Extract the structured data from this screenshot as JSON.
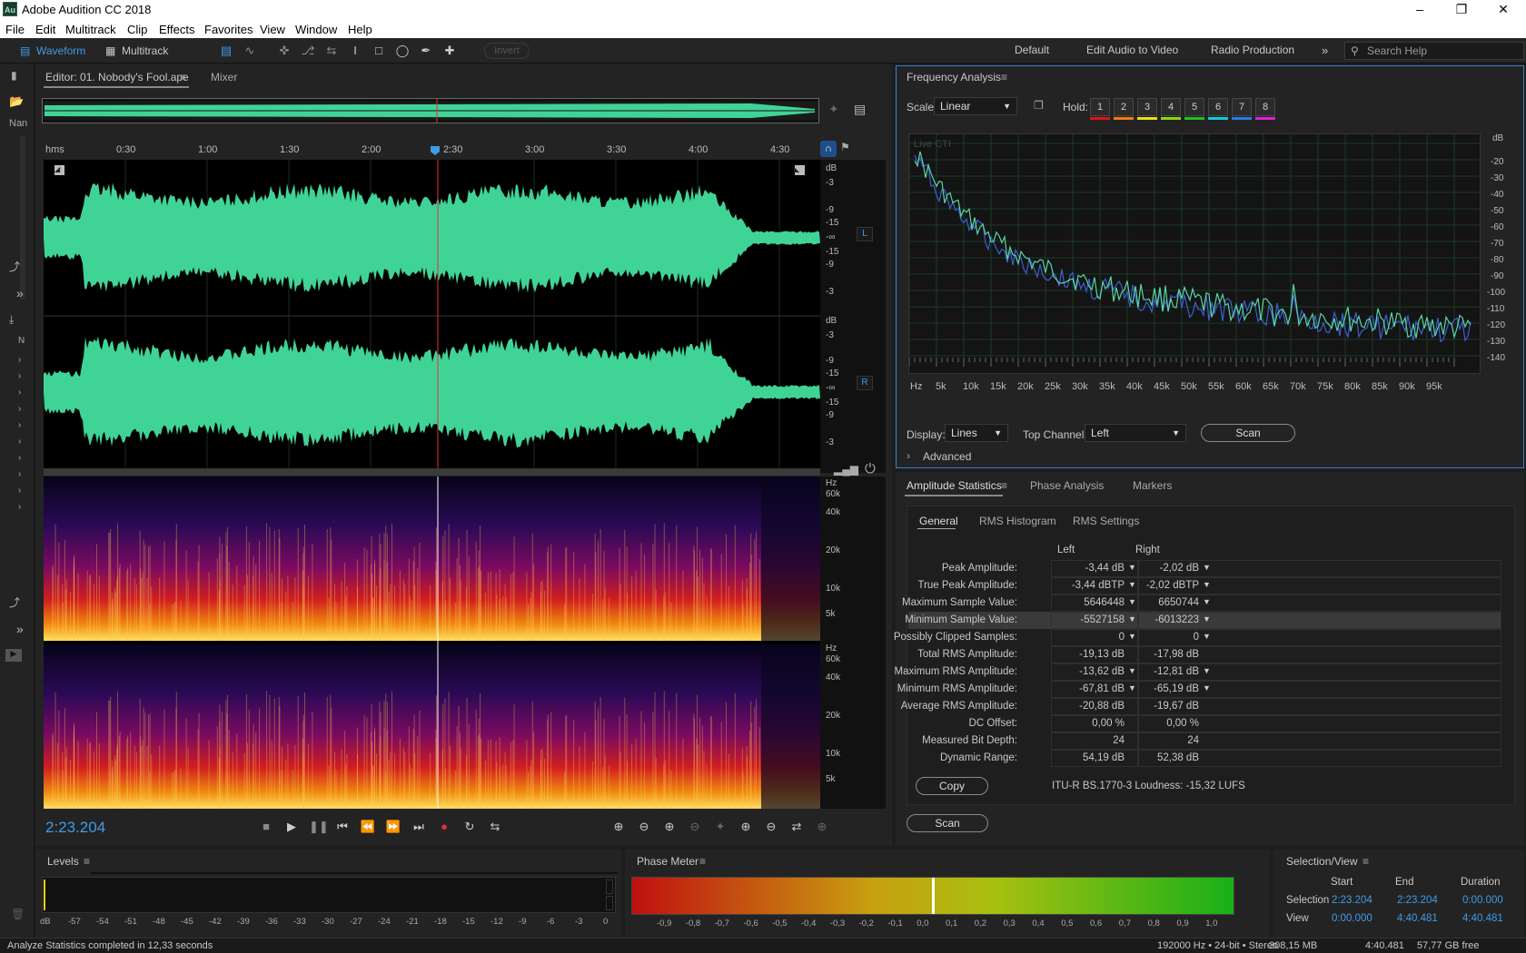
{
  "app": {
    "title": "Adobe Audition CC 2018",
    "logo": "Au"
  },
  "menu": [
    "File",
    "Edit",
    "Multitrack",
    "Clip",
    "Effects",
    "Favorites",
    "View",
    "Window",
    "Help"
  ],
  "toolbar": {
    "waveform_label": "Waveform",
    "multitrack_label": "Multitrack",
    "invert_label": "Invert",
    "workspaces": [
      "Default",
      "Edit Audio to Video",
      "Radio Production"
    ],
    "search_placeholder": "Search Help"
  },
  "left_strip": {
    "label_1": "Nan",
    "label_2": "N"
  },
  "editor": {
    "tab_label": "Editor: 01. Nobody's Fool.ape",
    "mixer_label": "Mixer",
    "ruler": {
      "unit": "hms",
      "ticks": [
        "0:30",
        "1:00",
        "1:30",
        "2:00",
        "2:30",
        "3:00",
        "3:30",
        "4:00",
        "4:30"
      ]
    },
    "channel_left": "L",
    "channel_right": "R",
    "db_unit": "dB",
    "db_labels_top": [
      "-3",
      "-9",
      "-15",
      "-∞",
      "-15",
      "-9",
      "-3"
    ],
    "db_labels_bottom": [
      "-3",
      "-9",
      "-15",
      "-∞",
      "-15",
      "-9",
      "-3"
    ],
    "hz_unit": "Hz",
    "hz_labels": [
      "60k",
      "40k",
      "20k",
      "10k",
      "5k"
    ],
    "timecode": "2:23.204"
  },
  "frequency_analysis": {
    "title": "Frequency Analysis",
    "scale_label": "Scale:",
    "scale_value": "Linear",
    "hold_label": "Hold:",
    "hold_buttons": [
      "1",
      "2",
      "3",
      "4",
      "5",
      "6",
      "7",
      "8"
    ],
    "hold_colors": [
      "#e01515",
      "#f07a10",
      "#e8e010",
      "#8ad814",
      "#20c020",
      "#12c8e0",
      "#2a7ae8",
      "#e020d8"
    ],
    "live_label": "Live CTI",
    "y_unit": "dB",
    "y_ticks": [
      "-20",
      "-30",
      "-40",
      "-50",
      "-60",
      "-70",
      "-80",
      "-90",
      "-100",
      "-110",
      "-120",
      "-130",
      "-140"
    ],
    "x_ticks": [
      "Hz",
      "5k",
      "10k",
      "15k",
      "20k",
      "25k",
      "30k",
      "35k",
      "40k",
      "45k",
      "50k",
      "55k",
      "60k",
      "65k",
      "70k",
      "75k",
      "80k",
      "85k",
      "90k",
      "95k"
    ],
    "display_label": "Display:",
    "display_value": "Lines",
    "top_channel_label": "Top Channel:",
    "top_channel_value": "Left",
    "scan_label": "Scan",
    "advanced_label": "Advanced"
  },
  "amplitude": {
    "tabs": [
      "Amplitude Statistics",
      "Phase Analysis",
      "Markers"
    ],
    "subtabs": [
      "General",
      "RMS Histogram",
      "RMS Settings"
    ],
    "col_left": "Left",
    "col_right": "Right",
    "rows": [
      {
        "label": "Peak Amplitude:",
        "left": "-3,44 dB",
        "right": "-2,02 dB",
        "pin": true
      },
      {
        "label": "True Peak Amplitude:",
        "left": "-3,44 dBTP",
        "right": "-2,02 dBTP",
        "pin": true
      },
      {
        "label": "Maximum Sample Value:",
        "left": "5646448",
        "right": "6650744",
        "pin": true
      },
      {
        "label": "Minimum Sample Value:",
        "left": "-5527158",
        "right": "-6013223",
        "pin": true
      },
      {
        "label": "Possibly Clipped Samples:",
        "left": "0",
        "right": "0",
        "pin": true
      },
      {
        "label": "Total RMS Amplitude:",
        "left": "-19,13 dB",
        "right": "-17,98 dB",
        "pin": false
      },
      {
        "label": "Maximum RMS Amplitude:",
        "left": "-13,62 dB",
        "right": "-12,81 dB",
        "pin": true
      },
      {
        "label": "Minimum RMS Amplitude:",
        "left": "-67,81 dB",
        "right": "-65,19 dB",
        "pin": true
      },
      {
        "label": "Average RMS Amplitude:",
        "left": "-20,88 dB",
        "right": "-19,67 dB",
        "pin": false
      },
      {
        "label": "DC Offset:",
        "left": "0,00 %",
        "right": "0,00 %",
        "pin": false
      },
      {
        "label": "Measured Bit Depth:",
        "left": "24",
        "right": "24",
        "pin": false
      },
      {
        "label": "Dynamic Range:",
        "left": "54,19 dB",
        "right": "52,38 dB",
        "pin": false
      }
    ],
    "copy_label": "Copy",
    "loudness": "ITU-R BS.1770-3 Loudness: -15,32 LUFS",
    "scan_label": "Scan"
  },
  "levels": {
    "title": "Levels",
    "ticks": [
      "dB",
      "-57",
      "-54",
      "-51",
      "-48",
      "-45",
      "-42",
      "-39",
      "-36",
      "-33",
      "-30",
      "-27",
      "-24",
      "-21",
      "-18",
      "-15",
      "-12",
      "-9",
      "-6",
      "-3",
      "0"
    ]
  },
  "phase_meter": {
    "title": "Phase Meter",
    "ticks": [
      "-0,9",
      "-0,8",
      "-0,7",
      "-0,6",
      "-0,5",
      "-0,4",
      "-0,3",
      "-0,2",
      "-0,1",
      "0,0",
      "0,1",
      "0,2",
      "0,3",
      "0,4",
      "0,5",
      "0,6",
      "0,7",
      "0,8",
      "0,9",
      "1,0"
    ]
  },
  "selection_view": {
    "title": "Selection/View",
    "col_start": "Start",
    "col_end": "End",
    "col_duration": "Duration",
    "selection_label": "Selection",
    "selection_start": "2:23.204",
    "selection_end": "2:23.204",
    "selection_duration": "0:00.000",
    "view_label": "View",
    "view_start": "0:00.000",
    "view_end": "4:40.481",
    "view_duration": "4:40.481"
  },
  "status": {
    "message": "Analyze Statistics completed in 12,33 seconds",
    "format": "192000 Hz • 24-bit • Stereo",
    "size": "308,15 MB",
    "duration": "4:40.481",
    "free": "57,77 GB free"
  }
}
